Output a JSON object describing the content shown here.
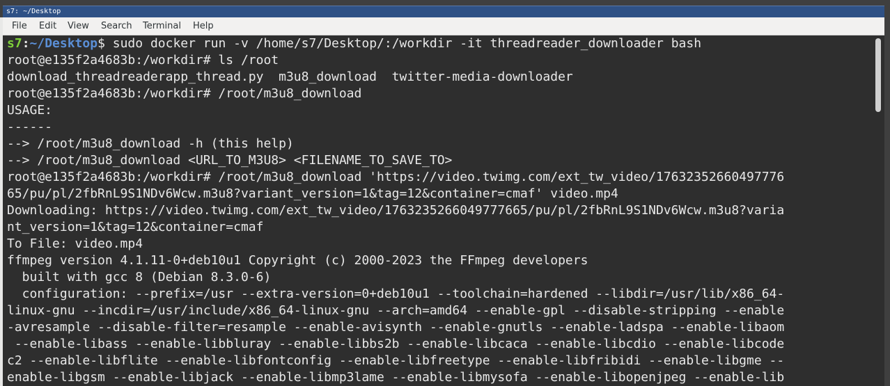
{
  "window": {
    "title": "s7: ~/Desktop"
  },
  "menubar": {
    "items": [
      "File",
      "Edit",
      "View",
      "Search",
      "Terminal",
      "Help"
    ]
  },
  "prompt": {
    "user": "s7",
    "colon": ":",
    "path": "~/Desktop",
    "dollar": "$",
    "command": " sudo docker run -v /home/s7/Desktop/:/workdir -it threadreader_downloader bash"
  },
  "terminal": {
    "lines": [
      "root@e135f2a4683b:/workdir# ls /root",
      "download_threadreaderapp_thread.py  m3u8_download  twitter-media-downloader",
      "root@e135f2a4683b:/workdir# /root/m3u8_download",
      "USAGE:",
      "------",
      "--> /root/m3u8_download -h (this help)",
      "--> /root/m3u8_download <URL_TO_M3U8> <FILENAME_TO_SAVE_TO>",
      "root@e135f2a4683b:/workdir# /root/m3u8_download 'https://video.twimg.com/ext_tw_video/17632352660497776",
      "65/pu/pl/2fbRnL9S1NDv6Wcw.m3u8?variant_version=1&tag=12&container=cmaf' video.mp4",
      "Downloading: https://video.twimg.com/ext_tw_video/1763235266049777665/pu/pl/2fbRnL9S1NDv6Wcw.m3u8?varia",
      "nt_version=1&tag=12&container=cmaf",
      "To File: video.mp4",
      "ffmpeg version 4.1.11-0+deb10u1 Copyright (c) 2000-2023 the FFmpeg developers",
      "  built with gcc 8 (Debian 8.3.0-6)",
      "  configuration: --prefix=/usr --extra-version=0+deb10u1 --toolchain=hardened --libdir=/usr/lib/x86_64-",
      "linux-gnu --incdir=/usr/include/x86_64-linux-gnu --arch=amd64 --enable-gpl --disable-stripping --enable",
      "-avresample --disable-filter=resample --enable-avisynth --enable-gnutls --enable-ladspa --enable-libaom",
      " --enable-libass --enable-libbluray --enable-libbs2b --enable-libcaca --enable-libcdio --enable-libcode",
      "c2 --enable-libflite --enable-libfontconfig --enable-libfreetype --enable-libfribidi --enable-libgme --",
      "enable-libgsm --enable-libjack --enable-libmp3lame --enable-libmysofa --enable-libopenjpeg --enable-lib"
    ]
  }
}
